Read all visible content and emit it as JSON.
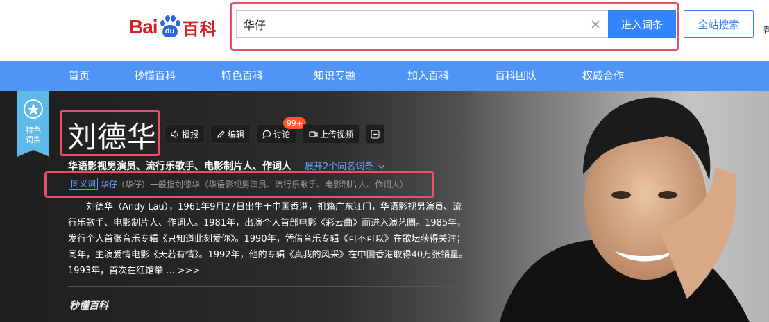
{
  "header": {
    "logo_bai": "Bai",
    "logo_du": "du",
    "logo_baike": "百科",
    "search_value": "华仔",
    "search_button": "进入词条",
    "site_search_button": "全站搜索",
    "cut_off_text": "帮"
  },
  "nav": {
    "items": [
      "首页",
      "秒懂百科",
      "特色百科",
      "知识专题",
      "加入百科",
      "百科团队",
      "权威合作"
    ]
  },
  "entry": {
    "special_tag": "特色\n词条",
    "title": "刘德华",
    "actions": {
      "play": "播报",
      "edit": "编辑",
      "discuss": "讨论",
      "discuss_badge": "99+",
      "upload_video": "上传视频"
    },
    "subtitle": "华语影视男演员、流行乐歌手、电影制片人、作词人",
    "expand_link": "展开2个同名词条",
    "synonym_tag": "同义词",
    "synonym_link": "华仔",
    "synonym_text": "（华仔）一般指刘德华（华语影视男演员、流行乐歌手、电影制片人、作词人）",
    "summary": "刘德华（Andy Lau），1961年9月27日出生于中国香港，祖籍广东江门，华语影视男演员、流行乐歌手、电影制片人、作词人。1981年，出演个人首部电影《彩云曲》而进入演艺圈。1985年，发行个人首张音乐专辑《只知道此刻爱你》。1990年，凭借音乐专辑《可不可以》在歌坛获得关注；同年，主演爱情电影《天若有情》。1992年，他的专辑《真我的风采》在中国香港取得40万张销量。1993年，首次在红馆举 ...",
    "more": ">>>",
    "brand": "秒懂百科"
  },
  "colors": {
    "nav_bg": "#4e95f5",
    "accent_blue": "#3385ff",
    "highlight_frame": "#e94f6a",
    "badge": "#ff5a26",
    "logo_red": "#de1d23"
  }
}
